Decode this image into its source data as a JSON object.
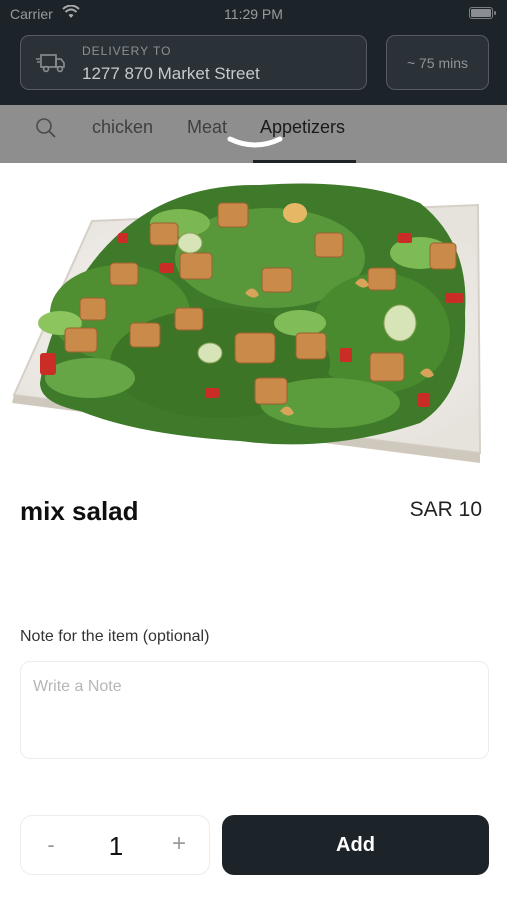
{
  "status_bar": {
    "carrier": "Carrier",
    "time": "11:29 PM"
  },
  "header": {
    "delivery_label": "DELIVERY TO",
    "delivery_address": "1277 870 Market Street",
    "eta": "~ 75 mins"
  },
  "categories": {
    "tabs": [
      {
        "label": "chicken"
      },
      {
        "label": "Meat"
      },
      {
        "label": "Appetizers",
        "active": true
      }
    ]
  },
  "item": {
    "name": "mix salad",
    "price": "SAR 10",
    "image_icon": "salad-photo"
  },
  "note": {
    "label": "Note for the item (optional)",
    "placeholder": "Write a Note",
    "value": ""
  },
  "quantity": {
    "minus": "-",
    "value": "1",
    "plus": "+"
  },
  "actions": {
    "add_label": "Add"
  },
  "colors": {
    "primary": "#1d2429",
    "overlay": "#8e8e8e"
  }
}
